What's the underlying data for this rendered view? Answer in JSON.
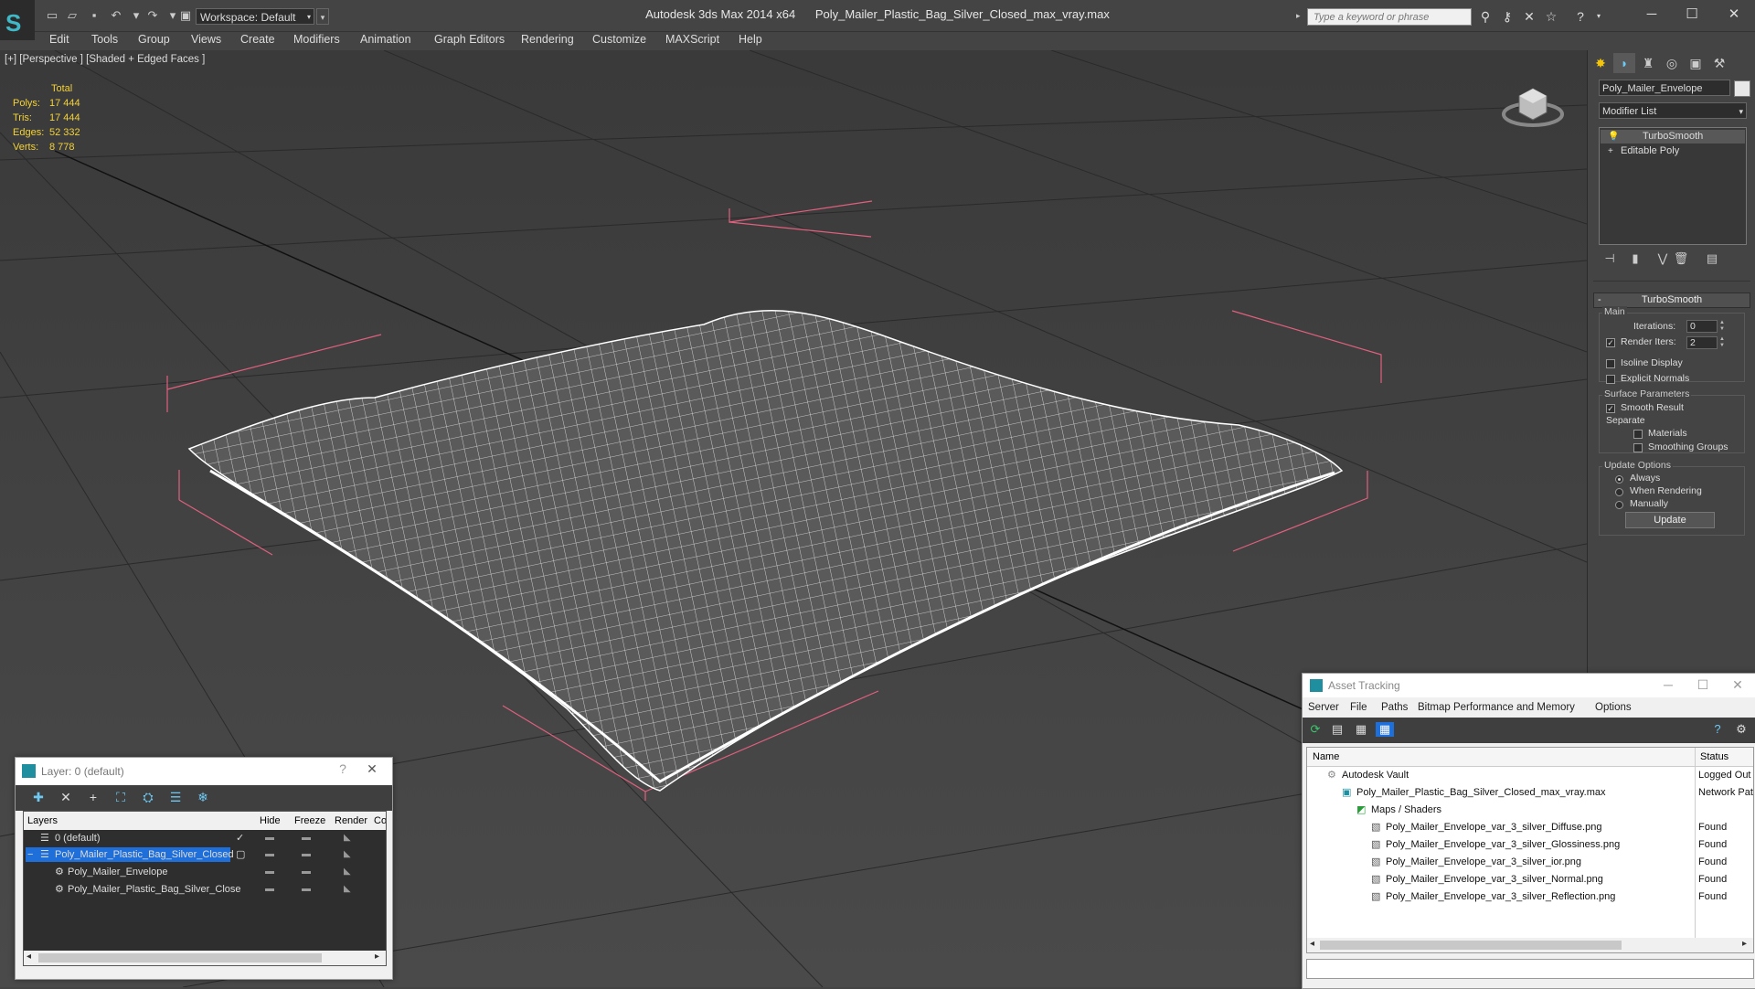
{
  "app": {
    "title": "Autodesk 3ds Max  2014 x64",
    "file": "Poly_Mailer_Plastic_Bag_Silver_Closed_max_vray.max",
    "workspace": "Workspace: Default",
    "search_placeholder": "Type a keyword or phrase"
  },
  "menu": [
    "Edit",
    "Tools",
    "Group",
    "Views",
    "Create",
    "Modifiers",
    "Animation",
    "Graph Editors",
    "Rendering",
    "Customize",
    "MAXScript",
    "Help"
  ],
  "viewport": {
    "label": "[+] [Perspective ] [Shaded + Edged Faces ]",
    "stats": {
      "header": "Total",
      "rows": [
        {
          "label": "Polys:",
          "value": "17 444"
        },
        {
          "label": "Tris:",
          "value": "17 444"
        },
        {
          "label": "Edges:",
          "value": "52 332"
        },
        {
          "label": "Verts:",
          "value": "8 778"
        }
      ]
    }
  },
  "command_panel": {
    "object_name": "Poly_Mailer_Envelope",
    "modifier_list": "Modifier List",
    "stack": [
      "TurboSmooth",
      "Editable Poly"
    ],
    "rollout_title": "TurboSmooth",
    "main_group": "Main",
    "iterations_label": "Iterations:",
    "iterations_value": "0",
    "render_iters_label": "Render Iters:",
    "render_iters_value": "2",
    "isoline_display": "Isoline Display",
    "explicit_normals": "Explicit Normals",
    "surface_group": "Surface Parameters",
    "smooth_result": "Smooth Result",
    "separate_label": "Separate",
    "materials": "Materials",
    "smoothing_groups": "Smoothing Groups",
    "update_group": "Update Options",
    "always": "Always",
    "when_rendering": "When Rendering",
    "manually": "Manually",
    "update_button": "Update"
  },
  "layer_dialog": {
    "title": "Layer: 0 (default)",
    "help": "?",
    "close": "✕",
    "columns": [
      "Layers",
      "Hide",
      "Freeze",
      "Render",
      "Co"
    ],
    "rows": [
      {
        "name": "0 (default)"
      },
      {
        "name": "Poly_Mailer_Plastic_Bag_Silver_Closed"
      },
      {
        "name": "Poly_Mailer_Envelope"
      },
      {
        "name": "Poly_Mailer_Plastic_Bag_Silver_Close"
      }
    ]
  },
  "asset_dialog": {
    "title": "Asset Tracking",
    "menu": [
      "Server",
      "File",
      "Paths",
      "Bitmap Performance and Memory",
      "Options"
    ],
    "columns": [
      "Name",
      "Status"
    ],
    "rows": [
      {
        "name": "Autodesk Vault",
        "status": "Logged Out"
      },
      {
        "name": "Poly_Mailer_Plastic_Bag_Silver_Closed_max_vray.max",
        "status": "Network Pat"
      },
      {
        "name": "Maps / Shaders",
        "status": ""
      },
      {
        "name": "Poly_Mailer_Envelope_var_3_silver_Diffuse.png",
        "status": "Found"
      },
      {
        "name": "Poly_Mailer_Envelope_var_3_silver_Glossiness.png",
        "status": "Found"
      },
      {
        "name": "Poly_Mailer_Envelope_var_3_silver_ior.png",
        "status": "Found"
      },
      {
        "name": "Poly_Mailer_Envelope_var_3_silver_Normal.png",
        "status": "Found"
      },
      {
        "name": "Poly_Mailer_Envelope_var_3_silver_Reflection.png",
        "status": "Found"
      }
    ]
  },
  "colors": {
    "stats_yellow": "#f3d23a",
    "wire": "#ffffff",
    "bbox_pink": "#e0607e",
    "selected_blue": "#1e6fd9"
  }
}
